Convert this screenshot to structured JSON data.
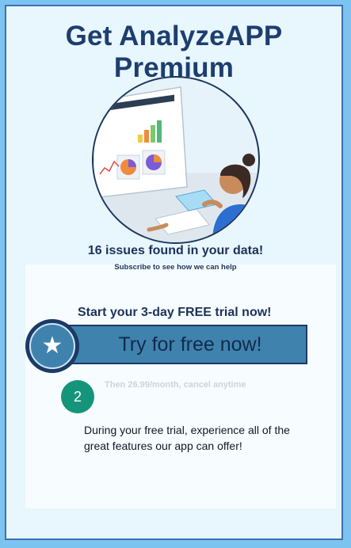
{
  "header": {
    "title": "Get AnalyzeAPP Premium"
  },
  "hero": {
    "illustration": "analytics-dashboard-illustration"
  },
  "summary": {
    "issues_text": "16 issues found in your data!",
    "subscribe_text": "Subscribe to see how we can help"
  },
  "trial": {
    "heading": "Start your 3-day FREE trial now!",
    "button_label": "Try for free now!",
    "button_icon": "star-icon",
    "step_number": "2",
    "price_note": "Then 26.99/month, cancel anytime",
    "feature_text": "During your free trial, experience all of the great features our app can offer!"
  },
  "colors": {
    "background": "#7cc4ef",
    "card": "#e8f6fd",
    "accent": "#3f82ae",
    "dark_blue": "#1b3a66",
    "teal": "#14957b"
  }
}
